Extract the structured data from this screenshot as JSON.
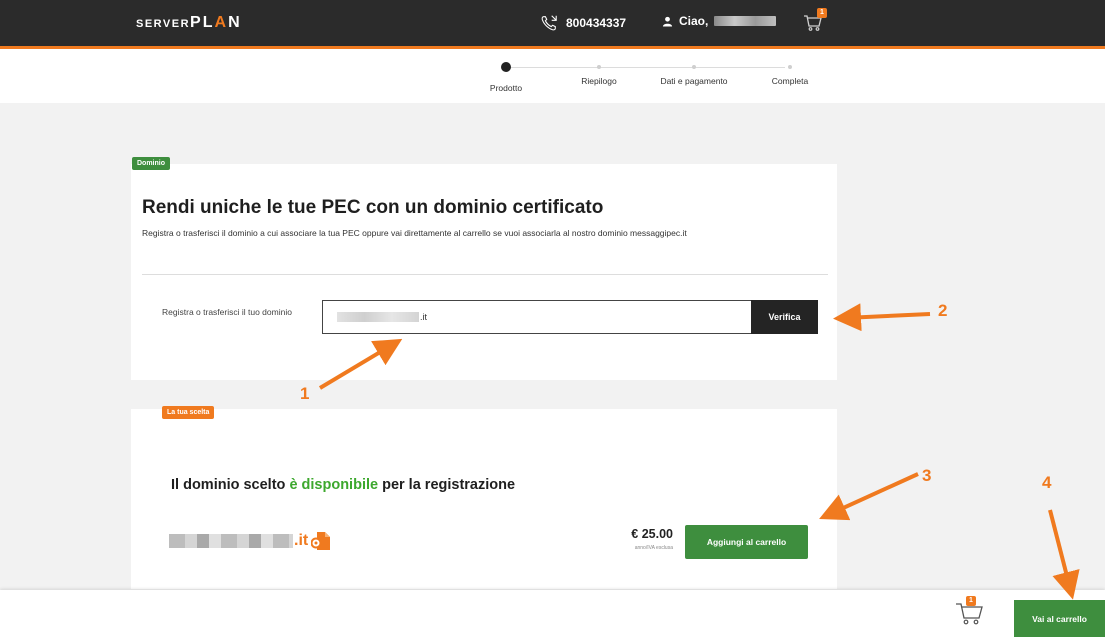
{
  "header": {
    "logo_server": "SERVER",
    "logo_plan_p": "PL",
    "logo_plan_a": "A",
    "logo_plan_n": "N",
    "phone": "800434337",
    "greeting": "Ciao,",
    "cart_count": "1"
  },
  "steps": [
    {
      "label": "Prodotto",
      "active": true
    },
    {
      "label": "Riepilogo",
      "active": false
    },
    {
      "label": "Dati e pagamento",
      "active": false
    },
    {
      "label": "Completa",
      "active": false
    }
  ],
  "domain_card": {
    "tag": "Dominio",
    "title": "Rendi uniche le tue PEC con un dominio certificato",
    "description": "Registra o trasferisci il dominio a cui associare la tua PEC oppure vai direttamente al carrello se vuoi associarla al nostro dominio messaggipec.it",
    "field_label": "Registra o trasferisci il tuo dominio",
    "input_suffix": ".it",
    "verify_label": "Verifica"
  },
  "choice_card": {
    "tag": "La tua scelta",
    "title_pre": "Il dominio scelto ",
    "title_highlight": "è disponibile",
    "title_post": " per la registrazione",
    "domain_suffix": ".it",
    "price": "€ 25.00",
    "price_note": "anno/IVA esclusa",
    "add_label": "Aggiungi al carrello"
  },
  "footer": {
    "cart_count": "1",
    "cart_button": "Vai al carrello"
  },
  "annotations": [
    "1",
    "2",
    "3",
    "4"
  ],
  "colors": {
    "accent": "#f07a1f",
    "green": "#3e8e3e",
    "available": "#3da82e",
    "dark": "#2b2b2b"
  }
}
